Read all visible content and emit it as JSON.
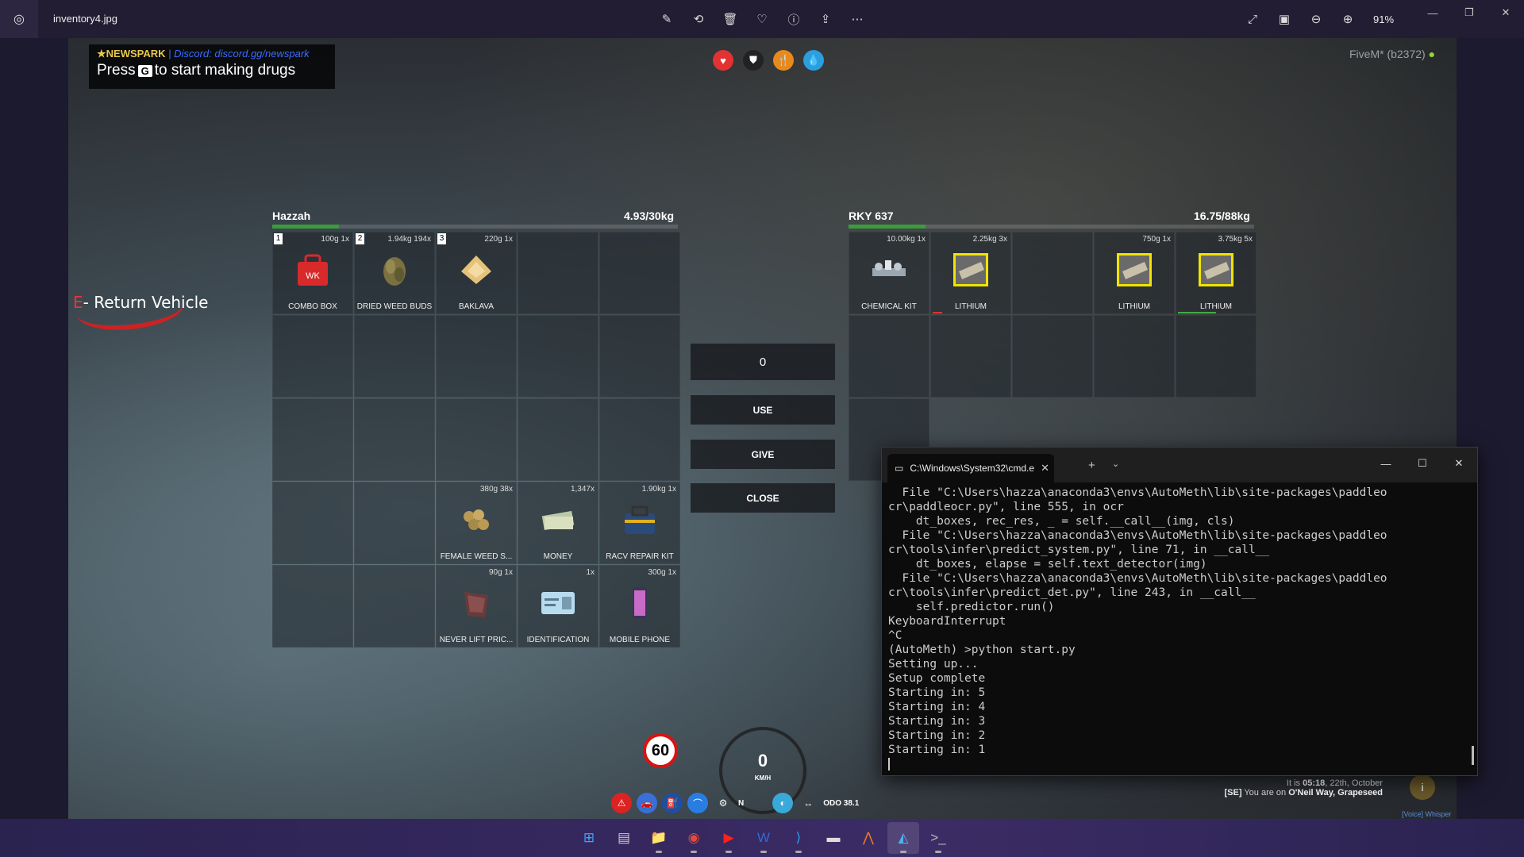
{
  "viewer": {
    "filename": "inventory4.jpg",
    "zoom": "91%",
    "tools": [
      "edit-icon",
      "rotate-icon",
      "delete-icon",
      "favorite-icon",
      "info-icon",
      "share-icon",
      "more-icon"
    ]
  },
  "hud": {
    "server_name": "NEWSPARK",
    "server_discord": "| Discord: discord.gg/newspark",
    "hint_prefix": "Press",
    "hint_key": "G",
    "hint_suffix": "to start making drugs",
    "fivem": "FiveM* (b2372)",
    "return_key": "E",
    "return_label": "- Return Vehicle",
    "speed_limit": "60",
    "speed": "0",
    "speed_unit": "KM/H",
    "heading": "N",
    "odo": "ODO 38.1",
    "clock_prefix": "It is",
    "clock_time": "05:18",
    "clock_date": ", 22th, October",
    "location_tag": "[SE]",
    "location_prefix": "You are on",
    "location": "O'Neil Way, Grapeseed",
    "voice": "[Voice] Whisper",
    "status_colors": {
      "health": "#e23232",
      "armor": "#222222",
      "hunger": "#e88a1a",
      "thirst": "#2b9ee0"
    }
  },
  "player_inventory": {
    "name": "Hazzah",
    "weight": "4.93/30kg",
    "weight_fraction": 0.164,
    "slots": [
      {
        "num": "1",
        "meta": "100g 1x",
        "label": "COMBO BOX",
        "icon": "combo-box-icon"
      },
      {
        "num": "2",
        "meta": "1.94kg 194x",
        "label": "DRIED WEED BUDS",
        "icon": "weed-buds-icon"
      },
      {
        "num": "3",
        "meta": "220g 1x",
        "label": "BAKLAVA",
        "icon": "baklava-icon"
      },
      {},
      {},
      {},
      {},
      {},
      {},
      {},
      {},
      {},
      {},
      {},
      {},
      {},
      {},
      {
        "meta": "380g 38x",
        "label": "FEMALE WEED S...",
        "icon": "weed-seeds-icon"
      },
      {
        "meta": "1,347x",
        "label": "MONEY",
        "icon": "money-icon"
      },
      {
        "meta": "1.90kg 1x",
        "label": "RACV REPAIR KIT",
        "icon": "repair-kit-icon"
      },
      {},
      {},
      {
        "meta": "90g 1x",
        "label": "NEVER LIFT PRIC...",
        "icon": "bag-icon"
      },
      {
        "meta": "1x",
        "label": "IDENTIFICATION",
        "icon": "id-card-icon"
      },
      {
        "meta": "300g 1x",
        "label": "MOBILE PHONE",
        "icon": "phone-icon"
      }
    ]
  },
  "controls": {
    "amount": "0",
    "use": "USE",
    "give": "GIVE",
    "close": "CLOSE"
  },
  "vehicle_inventory": {
    "name": "RKY 637",
    "weight": "16.75/88kg",
    "weight_fraction": 0.19,
    "slots": [
      {
        "meta": "10.00kg 1x",
        "label": "CHEMICAL KIT",
        "icon": "chemical-kit-icon"
      },
      {
        "meta": "2.25kg 3x",
        "label": "LITHIUM",
        "icon": "lithium-icon",
        "durability_color": "#d33"
      },
      {},
      {
        "meta": "750g 1x",
        "label": "LITHIUM",
        "icon": "lithium-icon"
      },
      {
        "meta": "3.75kg 5x",
        "label": "LITHIUM",
        "icon": "lithium-icon",
        "durability_color": "#4a4"
      },
      {},
      {},
      {},
      {},
      {},
      {}
    ]
  },
  "terminal": {
    "tab_title": "C:\\Windows\\System32\\cmd.e",
    "lines": [
      "  File \"C:\\Users\\hazza\\anaconda3\\envs\\AutoMeth\\lib\\site-packages\\paddleo",
      "cr\\paddleocr.py\", line 555, in ocr",
      "    dt_boxes, rec_res, _ = self.__call__(img, cls)",
      "  File \"C:\\Users\\hazza\\anaconda3\\envs\\AutoMeth\\lib\\site-packages\\paddleo",
      "cr\\tools\\infer\\predict_system.py\", line 71, in __call__",
      "    dt_boxes, elapse = self.text_detector(img)",
      "  File \"C:\\Users\\hazza\\anaconda3\\envs\\AutoMeth\\lib\\site-packages\\paddleo",
      "cr\\tools\\infer\\predict_det.py\", line 243, in __call__",
      "    self.predictor.run()",
      "KeyboardInterrupt",
      "^C",
      "(AutoMeth) >python start.py",
      "Setting up...",
      "Setup complete",
      "Starting in: 5",
      "Starting in: 4",
      "Starting in: 3",
      "Starting in: 2",
      "Starting in: 1"
    ]
  },
  "taskbar": {
    "apps": [
      {
        "icon": "windows-start-icon",
        "color": "#3ea6ff"
      },
      {
        "icon": "task-view-icon",
        "color": "#cccccc"
      },
      {
        "icon": "file-explorer-icon",
        "color": "#f2c230"
      },
      {
        "icon": "chrome-icon",
        "color": "#e04a3a"
      },
      {
        "icon": "youtube-music-icon",
        "color": "#ff2020"
      },
      {
        "icon": "word-icon",
        "color": "#2b6cd9"
      },
      {
        "icon": "vscode-icon",
        "color": "#2f9bec"
      },
      {
        "icon": "app-icon",
        "color": "#dddddd"
      },
      {
        "icon": "matlab-icon",
        "color": "#f07a20"
      },
      {
        "icon": "photos-icon",
        "color": "#4fb0f0"
      },
      {
        "icon": "terminal-icon",
        "color": "#bbbbbb"
      }
    ]
  }
}
